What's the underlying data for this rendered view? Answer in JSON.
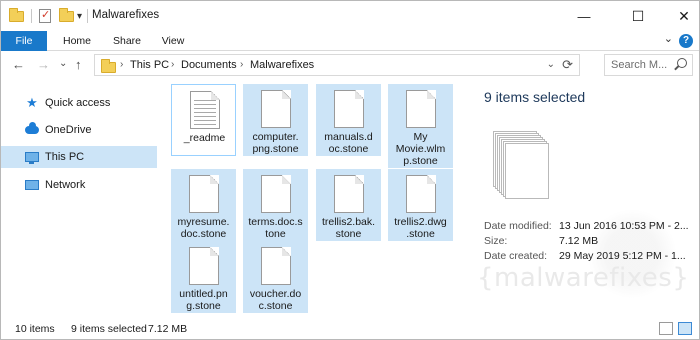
{
  "window": {
    "title": "Malwarefixes"
  },
  "titlebar": {
    "minimize_glyph": "—",
    "maximize_glyph": "☐",
    "close_glyph": "✕",
    "qa_dropdown_glyph": "▾"
  },
  "ribbon": {
    "tabs": [
      {
        "label": "File"
      },
      {
        "label": "Home"
      },
      {
        "label": "Share"
      },
      {
        "label": "View"
      }
    ],
    "expand_glyph": "⌄",
    "help_glyph": "?"
  },
  "address": {
    "back_glyph": "←",
    "forward_glyph": "→",
    "recent_glyph": "⌄",
    "up_glyph": "↑",
    "crumbs": [
      "This PC",
      "Documents",
      "Malwarefixes"
    ],
    "crumb_sep": "›",
    "chevron_glyph": "⌄",
    "refresh_glyph": "⟳",
    "search_placeholder": "Search M..."
  },
  "nav": {
    "items": [
      {
        "label": "Quick access",
        "icon": "star-icon"
      },
      {
        "label": "OneDrive",
        "icon": "cloud-icon"
      },
      {
        "label": "This PC",
        "icon": "computer-icon"
      },
      {
        "label": "Network",
        "icon": "network-icon"
      }
    ]
  },
  "files": [
    {
      "name": "_readme",
      "selected": false
    },
    {
      "name": "computer.png.stone",
      "display": "computer.\npng.stone",
      "selected": true
    },
    {
      "name": "manuals.doc.stone",
      "display": "manuals.d\noc.stone",
      "selected": true
    },
    {
      "name": "My Movie.wlmp.stone",
      "display": "My\nMovie.wlm\np.stone",
      "selected": true
    },
    {
      "name": "myresume.doc.stone",
      "display": "myresume.\ndoc.stone",
      "selected": true
    },
    {
      "name": "terms.doc.stone",
      "display": "terms.doc.s\ntone",
      "selected": true
    },
    {
      "name": "trellis2.bak.stone",
      "display": "trellis2.bak.\nstone",
      "selected": true
    },
    {
      "name": "trellis2.dwg.stone",
      "display": "trellis2.dwg\n.stone",
      "selected": true
    },
    {
      "name": "untitled.png.stone",
      "display": "untitled.pn\ng.stone",
      "selected": true
    },
    {
      "name": "voucher.doc.stone",
      "display": "voucher.do\nc.stone",
      "selected": true
    }
  ],
  "details": {
    "title": "9 items selected",
    "rows": [
      {
        "label": "Date modified:",
        "value": "13 Jun 2016 10:53 PM - 2..."
      },
      {
        "label": "Size:",
        "value": "7.12 MB"
      },
      {
        "label": "Date created:",
        "value": "29 May 2019 5:12 PM - 1..."
      }
    ],
    "watermark": "{malwarefixes}"
  },
  "status": {
    "count": "10 items",
    "selected": "9 items selected",
    "size": "7.12 MB"
  }
}
